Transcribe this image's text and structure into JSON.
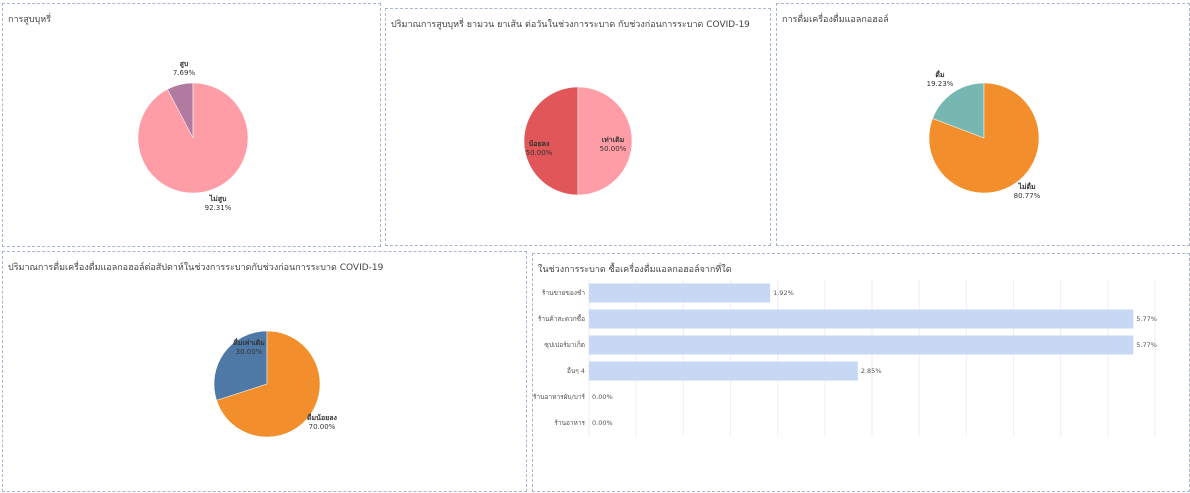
{
  "charts": {
    "smoking": {
      "title": "การสูบบุหรี่",
      "chart_data": {
        "type": "pie",
        "title": "การสูบบุหรี่",
        "slices": [
          {
            "name": "ไม่สูบ",
            "value": 92.31,
            "label": "92.31%",
            "color": "#ff9da7"
          },
          {
            "name": "สูบ",
            "value": 7.69,
            "label": "7.69%",
            "color": "#b07aa1"
          }
        ]
      }
    },
    "smoking_amount": {
      "title": "ปริมาณการสูบบุหรี่ ยามวน ยาเส้น ต่อวันในช่วงการระบาด กับช่วงก่อนการระบาด COVID-19",
      "chart_data": {
        "type": "pie",
        "title": "ปริมาณการสูบบุหรี่ ยามวน ยาเส้น ต่อวันในช่วงการระบาด กับช่วงก่อนการระบาด COVID-19",
        "slices": [
          {
            "name": "เท่าเดิม",
            "value": 50.0,
            "label": "50.00%",
            "color": "#ff9da7"
          },
          {
            "name": "น้อยลง",
            "value": 50.0,
            "label": "50.00%",
            "color": "#e15759"
          }
        ]
      }
    },
    "drinking": {
      "title": "การดื่มเครื่องดื่มแอลกอฮอล์",
      "chart_data": {
        "type": "pie",
        "title": "การดื่มเครื่องดื่มแอลกอฮอล์",
        "slices": [
          {
            "name": "ไม่ดื่ม",
            "value": 80.77,
            "label": "80.77%",
            "color": "#f28e2b"
          },
          {
            "name": "ดื่ม",
            "value": 19.23,
            "label": "19.23%",
            "color": "#76b7b2"
          }
        ]
      }
    },
    "drinking_amount": {
      "title": "ปริมาณการดื่มเครื่องดื่มแอลกอฮอล์ต่อสัปดาห์ในช่วงการระบาดกับช่วงก่อนการระบาด COVID-19",
      "chart_data": {
        "type": "pie",
        "title": "ปริมาณการดื่มเครื่องดื่มแอลกอฮอล์ต่อสัปดาห์ในช่วงการระบาดกับช่วงก่อนการระบาด COVID-19",
        "slices": [
          {
            "name": "ดื่มน้อยลง",
            "value": 70.0,
            "label": "70.00%",
            "color": "#f28e2b"
          },
          {
            "name": "ดื่มเท่าเดิม",
            "value": 30.0,
            "label": "30.00%",
            "color": "#4e79a7"
          }
        ]
      }
    },
    "purchase": {
      "title": "ในช่วงการระบาด ซื้อเครื่องดื่มแอลกอฮอล์จากที่ใด",
      "chart_data": {
        "type": "bar",
        "orientation": "horizontal",
        "title": "ในช่วงการระบาด ซื้อเครื่องดื่มแอลกอฮอล์จากที่ใด",
        "categories": [
          "ร้านขายของชำ",
          "ร้านค้าสะดวกซื้อ",
          "ซุปเปอร์มาเก็ต",
          "อื่นๆ 4",
          "ร้านอาหารผับ/บาร์",
          "ร้านอาหาร"
        ],
        "values": [
          1.92,
          5.77,
          5.77,
          2.85,
          0.0,
          0.0
        ],
        "labels": [
          "1.92%",
          "5.77%",
          "5.77%",
          "2.85%",
          "0.00%",
          "0.00%"
        ],
        "xlim": [
          0,
          6
        ],
        "color": "#c6d8f3"
      }
    }
  }
}
